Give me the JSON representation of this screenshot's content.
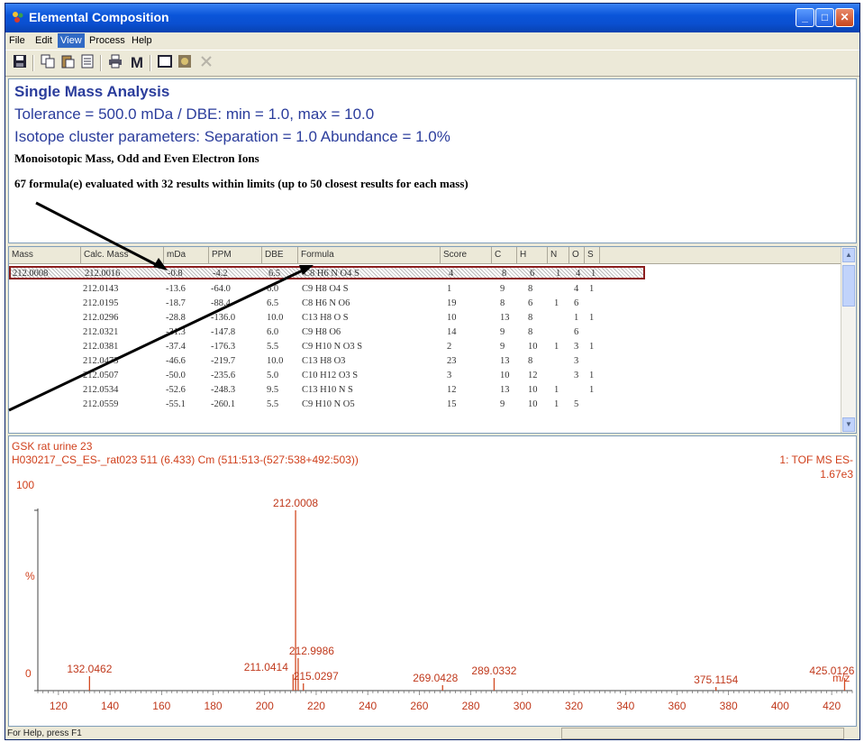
{
  "window": {
    "title": "Elemental Composition"
  },
  "title_buttons": {
    "minimize": "_",
    "maximize": "□",
    "close": "✕"
  },
  "menu": [
    "File",
    "Edit",
    "View",
    "Process",
    "Help"
  ],
  "toolbar": {
    "m_label": "M"
  },
  "info": {
    "title": "Single Mass Analysis",
    "tolerance": "Tolerance = 500.0 mDa  /  DBE: min = 1.0, max = 10.0",
    "isotope": "Isotope cluster parameters: Separation = 1.0   Abundance = 1.0%",
    "ions": "Monoisotopic Mass, Odd and Even Electron Ions",
    "summary": "67 formula(e) evaluated with 32 results within limits (up to 50 closest results for each mass)"
  },
  "table": {
    "columns": [
      "Mass",
      "Calc. Mass",
      "mDa",
      "PPM",
      "DBE",
      "Formula",
      "Score",
      "C",
      "H",
      "N",
      "O",
      "S"
    ],
    "selected_row": {
      "mass": "212.0008",
      "calc": "212.0016",
      "mda": "-0.8",
      "ppm": "-4.2",
      "dbe": "6.5",
      "formula": "C8 H6 N O4 S",
      "score": "4",
      "c": "8",
      "h": "6",
      "n": "1",
      "o": "4",
      "s": "1"
    },
    "rows": [
      {
        "calc": "212.0143",
        "mda": "-13.6",
        "ppm": "-64.0",
        "dbe": "6.0",
        "formula": "C9 H8 O4 S",
        "score": "1",
        "c": "9",
        "h": "8",
        "n": "",
        "o": "4",
        "s": "1"
      },
      {
        "calc": "212.0195",
        "mda": "-18.7",
        "ppm": "-88.4",
        "dbe": "6.5",
        "formula": "C8 H6 N O6",
        "score": "19",
        "c": "8",
        "h": "6",
        "n": "1",
        "o": "6",
        "s": ""
      },
      {
        "calc": "212.0296",
        "mda": "-28.8",
        "ppm": "-136.0",
        "dbe": "10.0",
        "formula": "C13 H8 O S",
        "score": "10",
        "c": "13",
        "h": "8",
        "n": "",
        "o": "1",
        "s": "1"
      },
      {
        "calc": "212.0321",
        "mda": "-31.3",
        "ppm": "-147.8",
        "dbe": "6.0",
        "formula": "C9 H8 O6",
        "score": "14",
        "c": "9",
        "h": "8",
        "n": "",
        "o": "6",
        "s": ""
      },
      {
        "calc": "212.0381",
        "mda": "-37.4",
        "ppm": "-176.3",
        "dbe": "5.5",
        "formula": "C9 H10 N O3 S",
        "score": "2",
        "c": "9",
        "h": "10",
        "n": "1",
        "o": "3",
        "s": "1"
      },
      {
        "calc": "212.0473",
        "mda": "-46.6",
        "ppm": "-219.7",
        "dbe": "10.0",
        "formula": "C13 H8 O3",
        "score": "23",
        "c": "13",
        "h": "8",
        "n": "",
        "o": "3",
        "s": ""
      },
      {
        "calc": "212.0507",
        "mda": "-50.0",
        "ppm": "-235.6",
        "dbe": "5.0",
        "formula": "C10 H12 O3 S",
        "score": "3",
        "c": "10",
        "h": "12",
        "n": "",
        "o": "3",
        "s": "1"
      },
      {
        "calc": "212.0534",
        "mda": "-52.6",
        "ppm": "-248.3",
        "dbe": "9.5",
        "formula": "C13 H10 N S",
        "score": "12",
        "c": "13",
        "h": "10",
        "n": "1",
        "o": "",
        "s": "1"
      },
      {
        "calc": "212.0559",
        "mda": "-55.1",
        "ppm": "-260.1",
        "dbe": "5.5",
        "formula": "C9 H10 N O5",
        "score": "15",
        "c": "9",
        "h": "10",
        "n": "1",
        "o": "5",
        "s": ""
      }
    ]
  },
  "spectrum": {
    "sample": "GSK rat urine 23",
    "scan": "H030217_CS_ES-_rat023 511 (6.433) Cm (511:513-(527:538+492:503))",
    "mode": "1: TOF MS ES-",
    "intensity": "1.67e3",
    "y_top_label": "100",
    "y_mid_label": "%",
    "y_zero_label": "0",
    "x_unit": "m/z"
  },
  "chart_data": {
    "type": "bar",
    "xlabel": "m/z",
    "ylabel": "%",
    "xlim": [
      112,
      428
    ],
    "ylim": [
      0,
      100
    ],
    "x_ticks": [
      120,
      140,
      160,
      180,
      200,
      220,
      240,
      260,
      280,
      300,
      320,
      340,
      360,
      380,
      400,
      420
    ],
    "peaks": [
      {
        "mz": 132.0462,
        "intensity": 8,
        "label": "132.0462"
      },
      {
        "mz": 211.0414,
        "intensity": 9,
        "label": "211.0414"
      },
      {
        "mz": 212.0008,
        "intensity": 100,
        "label": "212.0008"
      },
      {
        "mz": 212.9986,
        "intensity": 18,
        "label": "212.9986"
      },
      {
        "mz": 215.0297,
        "intensity": 4,
        "label": "215.0297"
      },
      {
        "mz": 269.0428,
        "intensity": 3,
        "label": "269.0428"
      },
      {
        "mz": 289.0332,
        "intensity": 7,
        "label": "289.0332"
      },
      {
        "mz": 375.1154,
        "intensity": 2,
        "label": "375.1154"
      },
      {
        "mz": 425.0126,
        "intensity": 7,
        "label": "425.0126"
      }
    ]
  },
  "status": {
    "text": "For Help, press F1"
  }
}
